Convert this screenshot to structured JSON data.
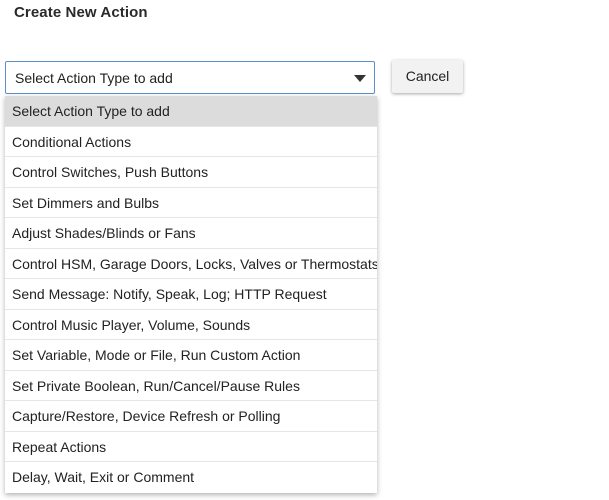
{
  "header": {
    "title": "Create New Action"
  },
  "select": {
    "value": "Select Action Type to add"
  },
  "cancel_label": "Cancel",
  "dropdown": {
    "selected_index": 0,
    "options": [
      "Select Action Type to add",
      "Conditional Actions",
      "Control Switches, Push Buttons",
      "Set Dimmers and Bulbs",
      "Adjust Shades/Blinds or Fans",
      "Control HSM, Garage Doors, Locks, Valves or Thermostats",
      "Send Message: Notify, Speak, Log; HTTP Request",
      "Control Music Player, Volume, Sounds",
      "Set Variable, Mode or File, Run Custom Action",
      "Set Private Boolean, Run/Cancel/Pause Rules",
      "Capture/Restore, Device Refresh or Polling",
      "Repeat Actions",
      "Delay, Wait, Exit or Comment"
    ]
  },
  "colors": {
    "select_border": "#5b8fc9",
    "selected_option_bg": "#dcdcdc",
    "button_bg": "#f2f2f2"
  }
}
